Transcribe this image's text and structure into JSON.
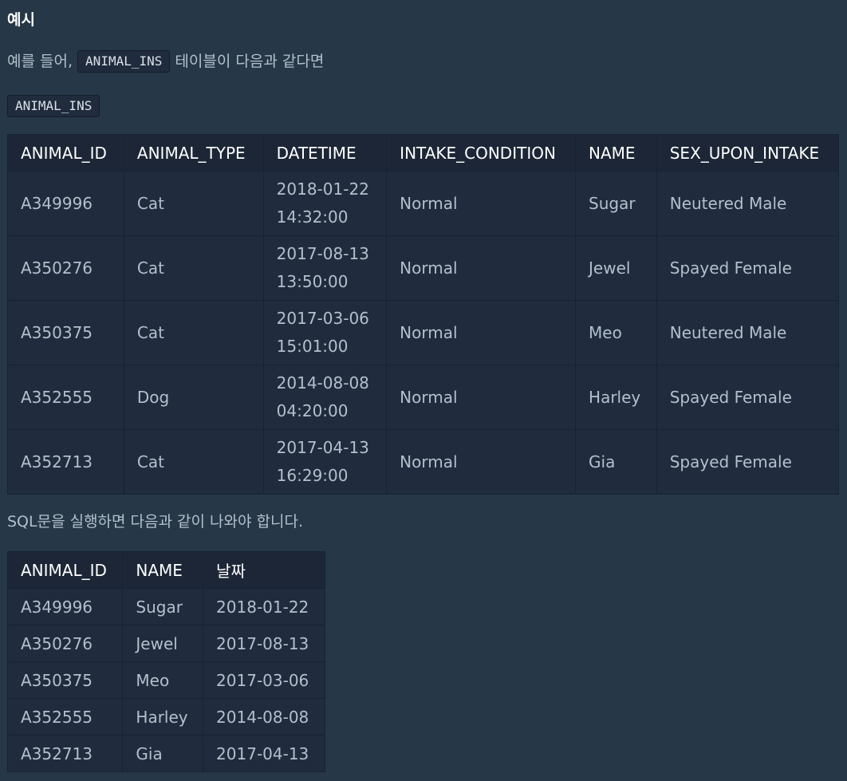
{
  "heading": "예시",
  "intro": {
    "before": "예를 들어,",
    "code": "ANIMAL_INS",
    "after": "테이블이 다음과 같다면"
  },
  "table_name": "ANIMAL_INS",
  "input_table": {
    "headers": [
      "ANIMAL_ID",
      "ANIMAL_TYPE",
      "DATETIME",
      "INTAKE_CONDITION",
      "NAME",
      "SEX_UPON_INTAKE"
    ],
    "rows": [
      {
        "id": "A349996",
        "type": "Cat",
        "date": "2018-01-22",
        "time": "14:32:00",
        "condition": "Normal",
        "name": "Sugar",
        "sex": "Neutered Male"
      },
      {
        "id": "A350276",
        "type": "Cat",
        "date": "2017-08-13",
        "time": "13:50:00",
        "condition": "Normal",
        "name": "Jewel",
        "sex": "Spayed Female"
      },
      {
        "id": "A350375",
        "type": "Cat",
        "date": "2017-03-06",
        "time": "15:01:00",
        "condition": "Normal",
        "name": "Meo",
        "sex": "Neutered Male"
      },
      {
        "id": "A352555",
        "type": "Dog",
        "date": "2014-08-08",
        "time": "04:20:00",
        "condition": "Normal",
        "name": "Harley",
        "sex": "Spayed Female"
      },
      {
        "id": "A352713",
        "type": "Cat",
        "date": "2017-04-13",
        "time": "16:29:00",
        "condition": "Normal",
        "name": "Gia",
        "sex": "Spayed Female"
      }
    ]
  },
  "result_text": "SQL문을 실행하면 다음과 같이 나와야 합니다.",
  "output_table": {
    "headers": [
      "ANIMAL_ID",
      "NAME",
      "날짜"
    ],
    "rows": [
      {
        "id": "A349996",
        "name": "Sugar",
        "date": "2018-01-22"
      },
      {
        "id": "A350276",
        "name": "Jewel",
        "date": "2017-08-13"
      },
      {
        "id": "A350375",
        "name": "Meo",
        "date": "2017-03-06"
      },
      {
        "id": "A352555",
        "name": "Harley",
        "date": "2014-08-08"
      },
      {
        "id": "A352713",
        "name": "Gia",
        "date": "2017-04-13"
      }
    ]
  },
  "colors": {
    "background": "#263747",
    "table_cell": "#202b3d",
    "table_header": "#1c2636",
    "text": "#b2c0cc",
    "header_text": "#ffffff"
  }
}
